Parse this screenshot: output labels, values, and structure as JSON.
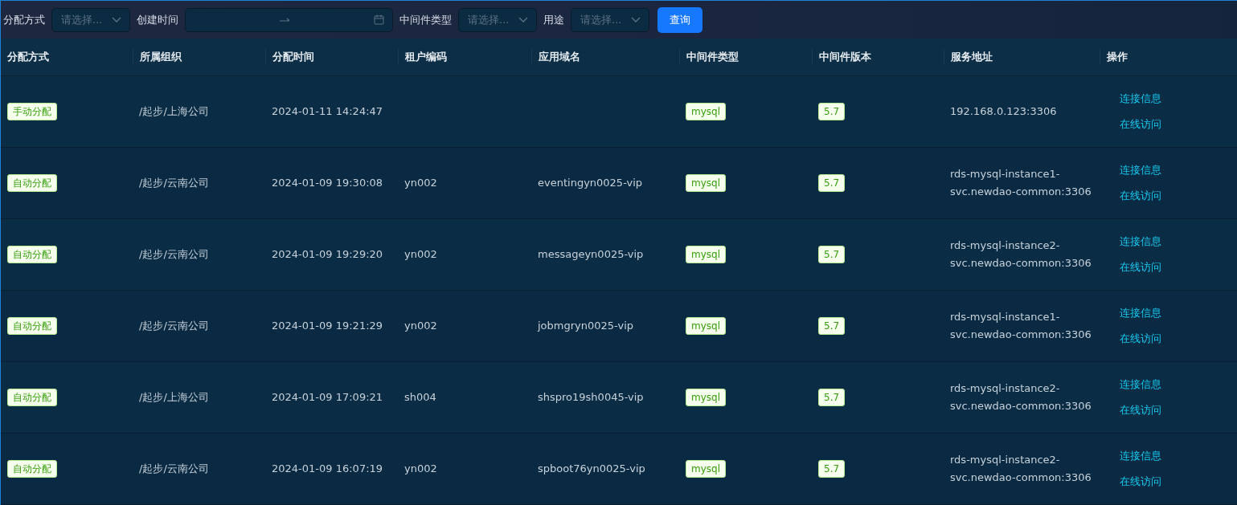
{
  "filters": [
    {
      "kind": "select",
      "label": "分配方式",
      "placeholder": "请选择..."
    },
    {
      "kind": "daterange",
      "label": "创建时间"
    },
    {
      "kind": "select",
      "label": "中间件类型",
      "placeholder": "请选择..."
    },
    {
      "kind": "select",
      "label": "用途",
      "placeholder": "请选择..."
    }
  ],
  "query_button": "查询",
  "table": {
    "columns": [
      "分配方式",
      "所属组织",
      "分配时间",
      "租户编码",
      "应用域名",
      "中间件类型",
      "中间件版本",
      "服务地址",
      "操作"
    ],
    "rows": [
      {
        "mode": "手动分配",
        "org": "/起步/上海公司",
        "time": "2024-01-11 14:24:47",
        "tenant": "",
        "domain": "",
        "type": "mysql",
        "version": "5.7",
        "address": "192.168.0.123:3306",
        "actions": [
          "连接信息",
          "在线访问"
        ]
      },
      {
        "mode": "自动分配",
        "org": "/起步/云南公司",
        "time": "2024-01-09 19:30:08",
        "tenant": "yn002",
        "domain": "eventingyn0025-vip",
        "type": "mysql",
        "version": "5.7",
        "address": "rds-mysql-instance1-svc.newdao-common:3306",
        "actions": [
          "连接信息",
          "在线访问"
        ]
      },
      {
        "mode": "自动分配",
        "org": "/起步/云南公司",
        "time": "2024-01-09 19:29:20",
        "tenant": "yn002",
        "domain": "messageyn0025-vip",
        "type": "mysql",
        "version": "5.7",
        "address": "rds-mysql-instance2-svc.newdao-common:3306",
        "actions": [
          "连接信息",
          "在线访问"
        ]
      },
      {
        "mode": "自动分配",
        "org": "/起步/云南公司",
        "time": "2024-01-09 19:21:29",
        "tenant": "yn002",
        "domain": "jobmgryn0025-vip",
        "type": "mysql",
        "version": "5.7",
        "address": "rds-mysql-instance1-svc.newdao-common:3306",
        "actions": [
          "连接信息",
          "在线访问"
        ]
      },
      {
        "mode": "自动分配",
        "org": "/起步/上海公司",
        "time": "2024-01-09 17:09:21",
        "tenant": "sh004",
        "domain": "shspro19sh0045-vip",
        "type": "mysql",
        "version": "5.7",
        "address": "rds-mysql-instance2-svc.newdao-common:3306",
        "actions": [
          "连接信息",
          "在线访问"
        ]
      },
      {
        "mode": "自动分配",
        "org": "/起步/云南公司",
        "time": "2024-01-09 16:07:19",
        "tenant": "yn002",
        "domain": "spboot76yn0025-vip",
        "type": "mysql",
        "version": "5.7",
        "address": "rds-mysql-instance2-svc.newdao-common:3306",
        "actions": [
          "连接信息",
          "在线访问"
        ]
      }
    ]
  }
}
